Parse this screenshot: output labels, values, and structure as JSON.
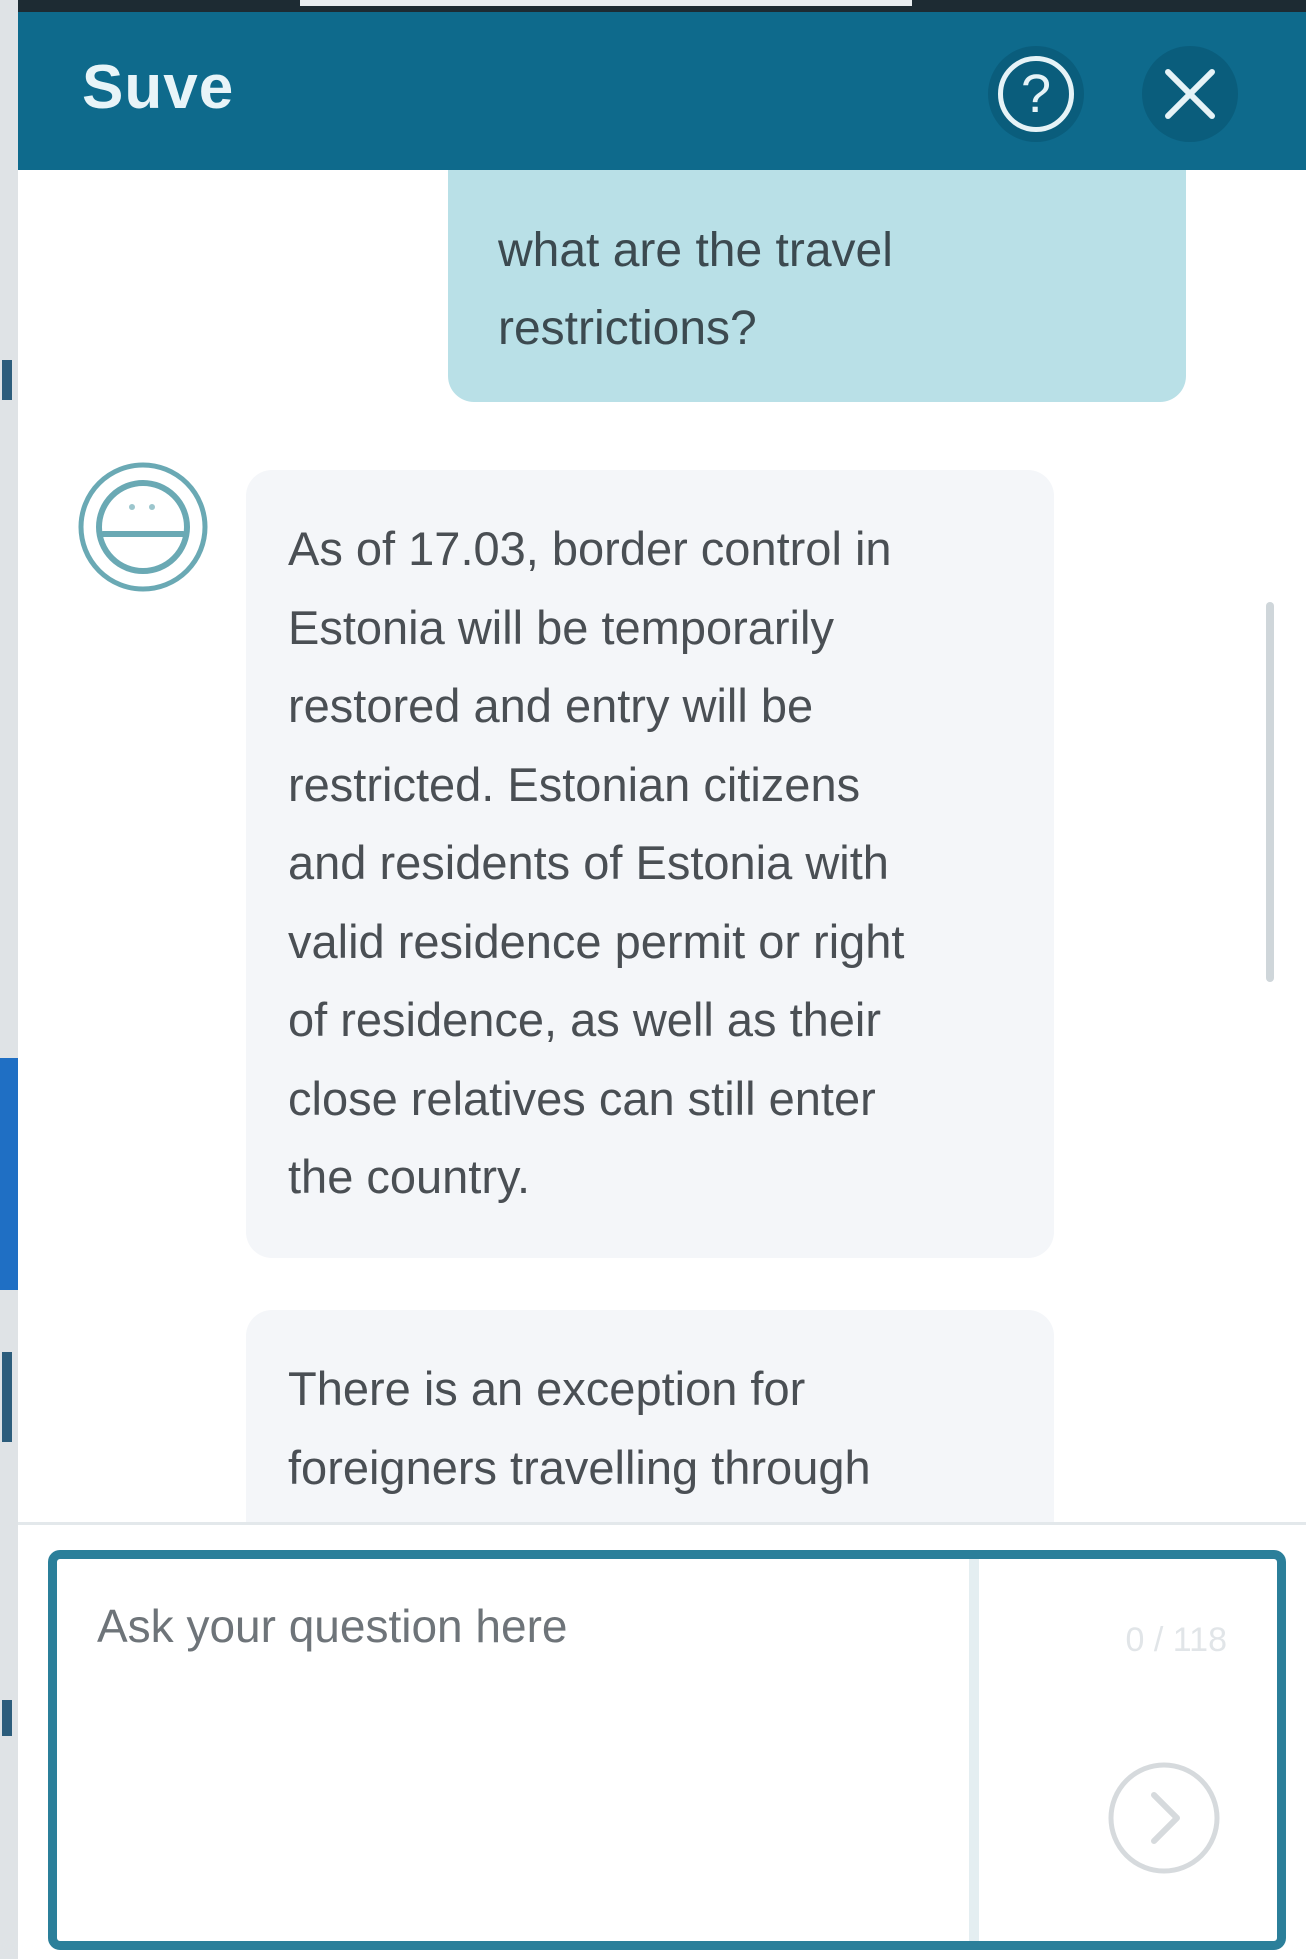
{
  "header": {
    "title": "Suve",
    "help_label": "?"
  },
  "conversation": {
    "user_message": {
      "line1": "what are the travel",
      "line2": "restrictions?"
    },
    "bot_message_1": [
      "As of 17.03, border control in",
      "Estonia will be temporarily",
      "restored and entry will be",
      "restricted. Estonian citizens",
      "and residents of Estonia with",
      "valid residence permit or right",
      "of residence, as well as their",
      "close relatives can still enter",
      "the country."
    ],
    "bot_message_2": [
      "There is an exception for",
      "foreigners travelling through"
    ]
  },
  "composer": {
    "placeholder": "Ask your question here",
    "char_counter": "0 / 118"
  },
  "colors": {
    "header_bg": "#0e6a8c",
    "user_bubble_bg": "#b9e0e7",
    "bot_bubble_bg": "#f4f6f9",
    "composer_border": "#2b7f9a"
  }
}
